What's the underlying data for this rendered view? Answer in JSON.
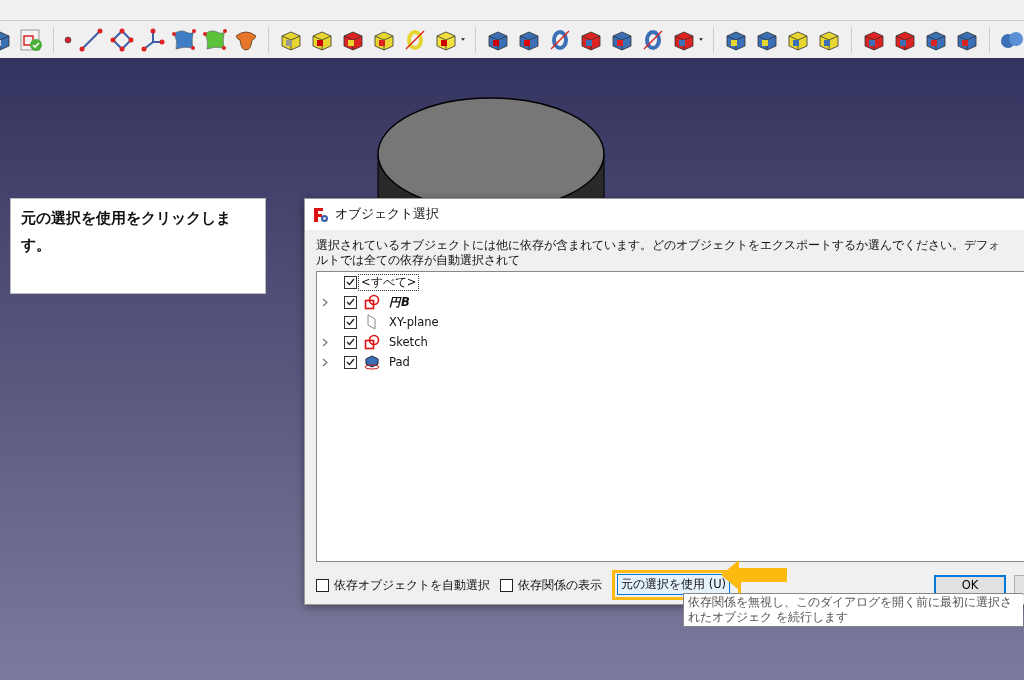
{
  "callout": {
    "text": "元の選択を使用をクリックします。"
  },
  "dialog": {
    "title": "オブジェクト選択",
    "description": "選択されているオブジェクトには他に依存が含まれています。どのオブジェクトをエクスポートするか選んでください。デフォルトでは全ての依存が自動選択されて",
    "tree": [
      {
        "label": "<すべて>",
        "kind": "none",
        "expandable": false,
        "checked": true,
        "italic": false,
        "focused": true
      },
      {
        "label": "円B",
        "kind": "sketch",
        "expandable": true,
        "checked": true,
        "italic": true,
        "focused": false
      },
      {
        "label": "XY-plane",
        "kind": "plane",
        "expandable": false,
        "checked": true,
        "italic": false,
        "focused": false
      },
      {
        "label": "Sketch",
        "kind": "sketch",
        "expandable": true,
        "checked": true,
        "italic": false,
        "focused": false
      },
      {
        "label": "Pad",
        "kind": "body",
        "expandable": true,
        "checked": true,
        "italic": false,
        "focused": false
      }
    ],
    "options": [
      {
        "label": "依存オブジェクトを自動選択",
        "checked": false
      },
      {
        "label": "依存関係の表示",
        "checked": false
      }
    ],
    "use_original_button": "元の選択を使用 (U)",
    "ok_button": "OK",
    "tooltip": "依存関係を無視し、このダイアログを開く前に最初に選択されたオブジェク を続行します"
  }
}
